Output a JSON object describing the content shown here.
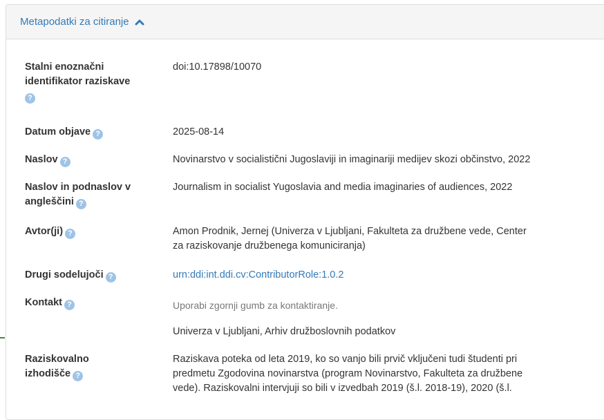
{
  "panel": {
    "heading": "Metapodatki za citiranje",
    "help_glyph": "?"
  },
  "icons": {
    "collapse": "chevron-up-icon",
    "help": "question-circle-icon"
  },
  "colors": {
    "link": "#337ab7",
    "help_icon": "#9fc3e6",
    "heading_bg": "#f5f5f5"
  },
  "fields": {
    "pid": {
      "label_line1": "Stalni enoznačni",
      "label_line2": "identifikator raziskave",
      "value": "doi:10.17898/10070"
    },
    "date": {
      "label": "Datum objave",
      "value": "2025-08-14"
    },
    "title": {
      "label": "Naslov",
      "value": "Novinarstvo v socialistični Jugoslaviji in imaginariji medijev skozi občinstvo, 2022"
    },
    "title_en": {
      "label_line1": "Naslov in podnaslov v",
      "label_line2": "angleščini",
      "value": "Journalism in socialist Yugoslavia and media imaginaries of audiences, 2022"
    },
    "authors": {
      "label": "Avtor(ji)",
      "value_line1": "Amon Prodnik, Jernej (Univerza v Ljubljani, Fakulteta za družbene vede, Center",
      "value_line2": "za raziskovanje družbenega komuniciranja)"
    },
    "contributors": {
      "label": "Drugi sodelujoči",
      "value": "urn:ddi:int.ddi.cv:ContributorRole:1.0.2"
    },
    "contact": {
      "label": "Kontakt",
      "hint": "Uporabi zgornji gumb za kontaktiranje.",
      "value": "Univerza v Ljubljani, Arhiv družboslovnih podatkov"
    },
    "background": {
      "label_line1": "Raziskovalno",
      "label_line2": "izhodišče",
      "value_line1": "Raziskava poteka od leta 2019, ko so vanjo bili prvič vključeni tudi študenti pri",
      "value_line2": "predmetu Zgodovina novinarstva (program Novinarstvo, Fakulteta za družbene",
      "value_line3": "vede). Raziskovalni intervjuji so bili v izvedbah 2019 (š.l. 2018-19), 2020 (š.l."
    }
  }
}
